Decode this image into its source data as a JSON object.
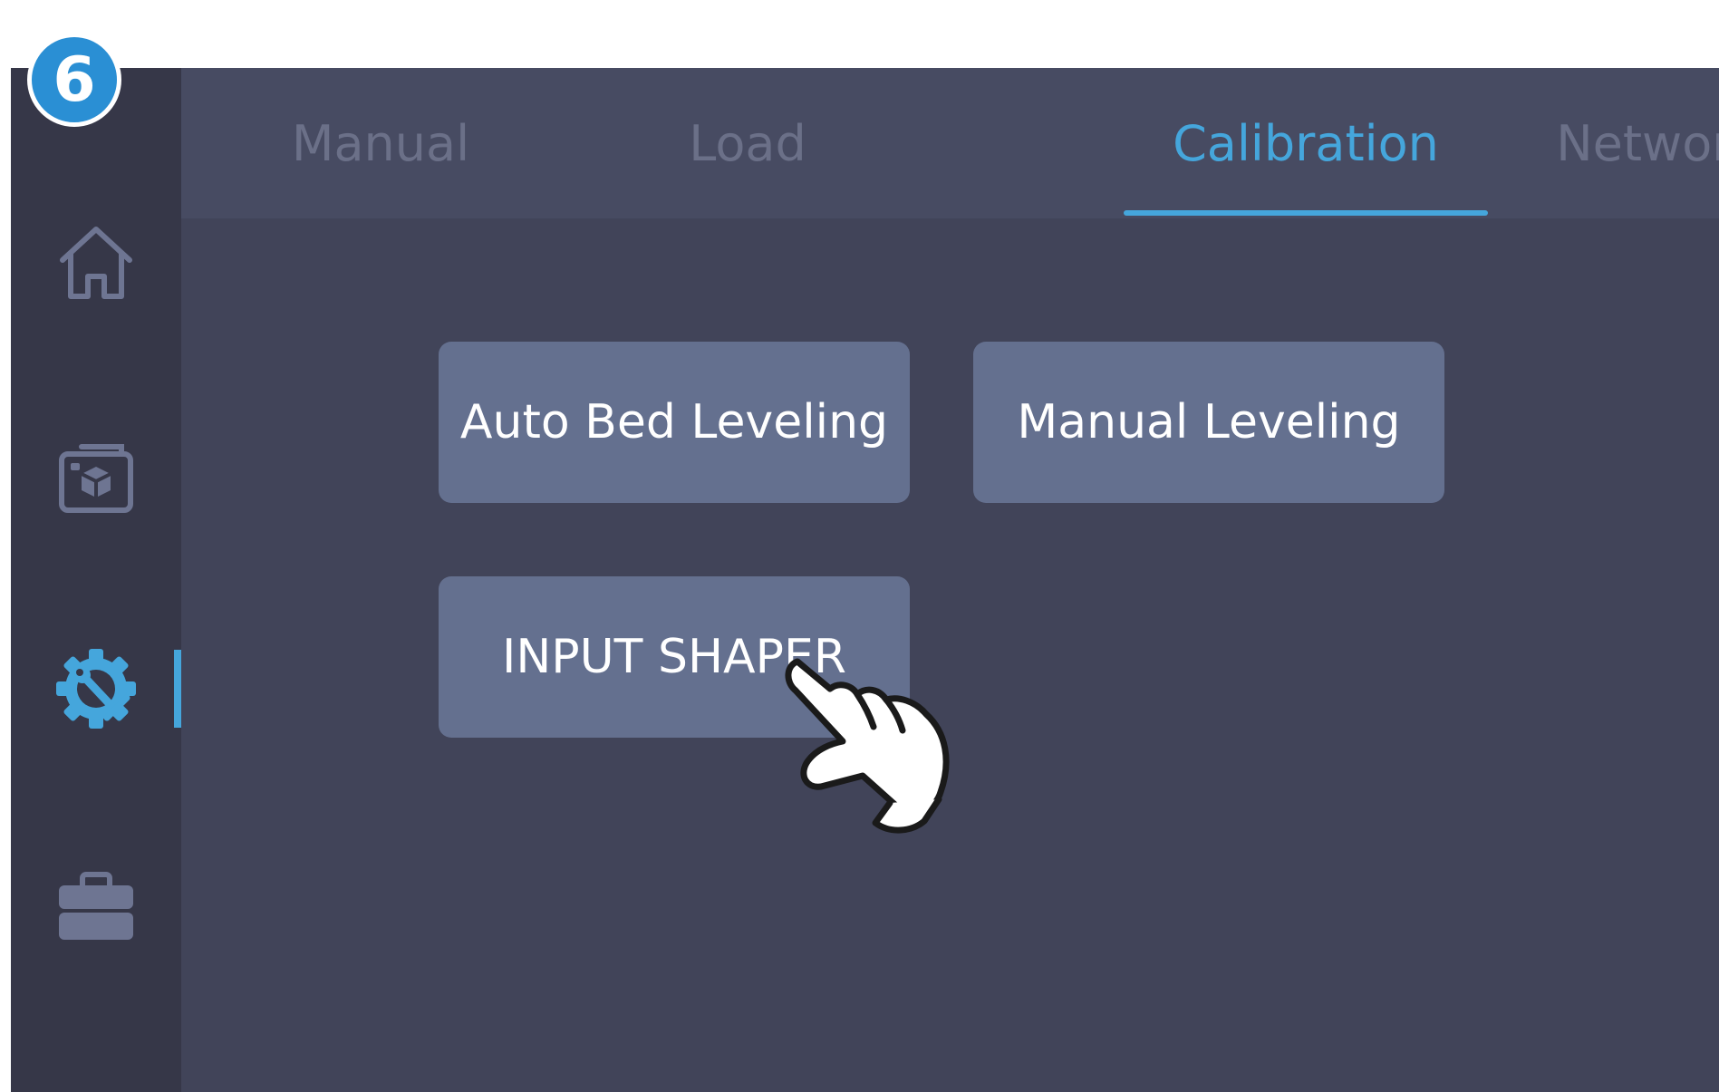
{
  "step_badge": "6",
  "sidebar": {
    "items": [
      {
        "icon": "home-icon",
        "active": false
      },
      {
        "icon": "print-files-icon",
        "active": false
      },
      {
        "icon": "settings-icon",
        "active": true
      },
      {
        "icon": "toolbox-icon",
        "active": false
      }
    ]
  },
  "tabs": [
    {
      "label": "Manual",
      "active": false
    },
    {
      "label": "Load",
      "active": false
    },
    {
      "label": "Calibration",
      "active": true
    },
    {
      "label": "Network",
      "active": false
    }
  ],
  "buttons": {
    "auto_bed_leveling": "Auto Bed Leveling",
    "manual_leveling": "Manual Leveling",
    "input_shaper": "INPUT SHAPER"
  },
  "colors": {
    "accent": "#45a6dc",
    "background": "#414459",
    "sidebar": "#363748",
    "tab_bar": "#474b62",
    "button": "#64708f",
    "inactive_text": "#6b7088",
    "badge": "#2a8fd4"
  },
  "pointer": {
    "icon": "tap-hand-icon"
  }
}
